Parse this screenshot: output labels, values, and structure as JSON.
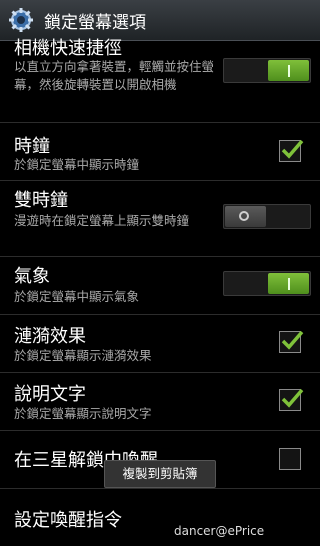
{
  "header": {
    "title": "鎖定螢幕選項",
    "icon": "gear-icon"
  },
  "settings": [
    {
      "title": "相機快速捷徑",
      "summary": "以直立方向拿著裝置，輕觸並按住螢幕，然後旋轉裝置以開啟相機",
      "control": "toggle",
      "state": "on"
    },
    {
      "title": "時鐘",
      "summary": "於鎖定螢幕中顯示時鐘",
      "control": "checkbox",
      "state": "checked"
    },
    {
      "title": "雙時鐘",
      "summary": "漫遊時在鎖定螢幕上顯示雙時鐘",
      "control": "toggle",
      "state": "off"
    },
    {
      "title": "氣象",
      "summary": "於鎖定螢幕中顯示氣象",
      "control": "toggle",
      "state": "on"
    },
    {
      "title": "漣漪效果",
      "summary": "於鎖定螢幕顯示漣漪效果",
      "control": "checkbox",
      "state": "checked"
    },
    {
      "title": "說明文字",
      "summary": "於鎖定螢幕顯示說明文字",
      "control": "checkbox",
      "state": "checked"
    },
    {
      "title": "在三星解鎖中喚醒",
      "summary": "",
      "control": "checkbox",
      "state": "unchecked"
    },
    {
      "title": "設定喚醒指令",
      "summary": "",
      "control": "none",
      "state": ""
    }
  ],
  "toast": {
    "text": "複製到剪貼簿"
  },
  "watermark": {
    "text": "dancer@ePrice"
  },
  "colors": {
    "toggle_on": "#6aaa2a",
    "check": "#7fc23a",
    "background": "#000000"
  }
}
